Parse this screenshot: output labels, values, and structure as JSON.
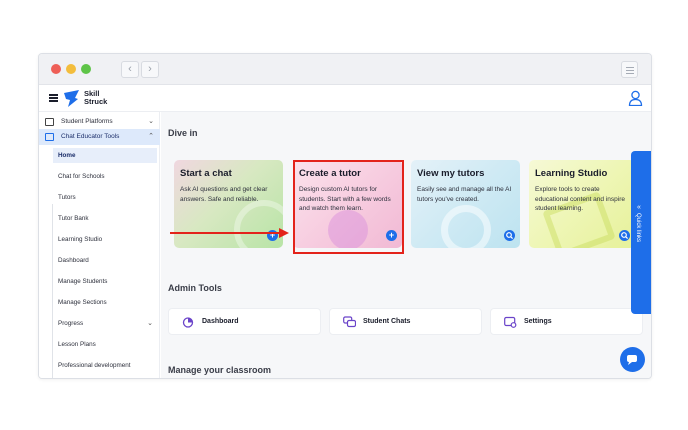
{
  "window": {
    "back_glyph": "‹",
    "forward_glyph": "›"
  },
  "brand": {
    "line1": "Skill",
    "line2": "Struck",
    "color": "#1e6ee9"
  },
  "sidebar": {
    "groups": [
      {
        "label": "Student Platforms",
        "icon": "monitor-icon",
        "chevron": "⌄"
      },
      {
        "label": "Chat Educator Tools",
        "icon": "chat-sparkle-icon",
        "chevron": "⌃"
      }
    ],
    "items": [
      {
        "label": "Home",
        "active": true
      },
      {
        "label": "Chat for Schools"
      },
      {
        "label": "Tutors"
      },
      {
        "label": "Tutor Bank"
      },
      {
        "label": "Learning Studio"
      },
      {
        "label": "Dashboard"
      },
      {
        "label": "Manage Students"
      },
      {
        "label": "Manage Sections"
      },
      {
        "label": "Progress",
        "chevron": "⌄"
      },
      {
        "label": "Lesson Plans"
      },
      {
        "label": "Professional development"
      }
    ]
  },
  "main": {
    "dive_in_title": "Dive in",
    "cards": [
      {
        "title": "Start a chat",
        "desc": "Ask AI questions and get clear answers. Safe and reliable.",
        "action": "+",
        "action_icon": "plus-icon"
      },
      {
        "title": "Create a tutor",
        "desc": "Design custom AI tutors for students. Start with a few words and watch them learn.",
        "action": "+",
        "action_icon": "plus-icon"
      },
      {
        "title": "View my tutors",
        "desc": "Easily see and manage all the AI tutors you've created.",
        "action_icon": "search-icon"
      },
      {
        "title": "Learning Studio",
        "desc": "Explore tools to create educational content and inspire student learning.",
        "action_icon": "search-icon"
      }
    ],
    "admin_title": "Admin Tools",
    "admin_tools": [
      {
        "label": "Dashboard",
        "icon": "pie-chart-icon"
      },
      {
        "label": "Student Chats",
        "icon": "chat-bubbles-icon"
      },
      {
        "label": "Settings",
        "icon": "settings-sliders-icon"
      }
    ],
    "manage_title": "Manage your classroom",
    "quick_links": {
      "label": "Quick links",
      "chevron": "«"
    }
  },
  "colors": {
    "accent": "#1e6ee9",
    "highlight": "#e3231b"
  }
}
